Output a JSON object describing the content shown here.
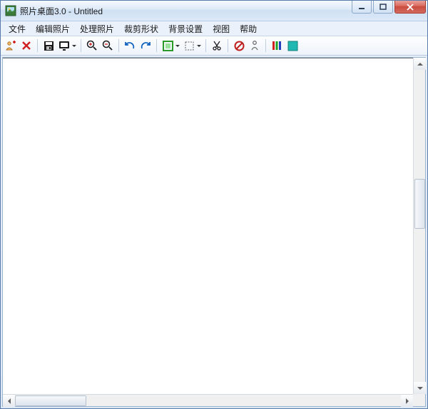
{
  "window": {
    "title": "照片桌面3.0 - Untitled"
  },
  "menubar": {
    "items": [
      {
        "label": "文件"
      },
      {
        "label": "编辑照片"
      },
      {
        "label": "处理照片"
      },
      {
        "label": "裁剪形状"
      },
      {
        "label": "背景设置"
      },
      {
        "label": "视图"
      },
      {
        "label": "帮助"
      }
    ]
  },
  "toolbar": {
    "groups": "add-exit | save preview | zoom-in zoom-out | undo redo | rect rect-dashed | cut | no-entry person | bars swatch"
  }
}
